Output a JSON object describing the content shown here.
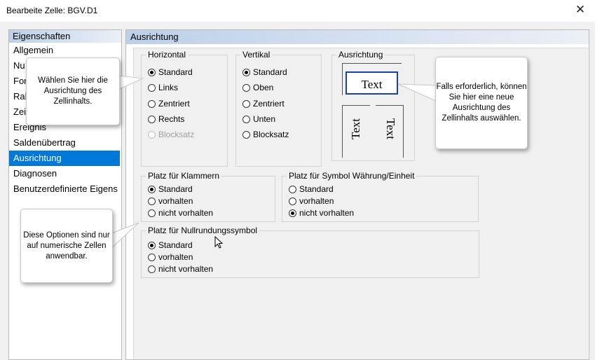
{
  "window": {
    "title": "Bearbeite Zelle: BGV.D1"
  },
  "sidebar": {
    "header": "Eigenschaften",
    "items": [
      {
        "label": "Allgemein"
      },
      {
        "label": "Nu"
      },
      {
        "label": "For"
      },
      {
        "label": "Rah"
      },
      {
        "label": "Zei"
      },
      {
        "label": "Ereignis"
      },
      {
        "label": "Saldenübertrag"
      },
      {
        "label": "Ausrichtung"
      },
      {
        "label": "Diagnosen"
      },
      {
        "label": "Benutzerdefinierte Eigens"
      }
    ],
    "selected_index": 7
  },
  "main": {
    "header": "Ausrichtung",
    "horizontal": {
      "legend": "Horizontal",
      "options": [
        "Standard",
        "Links",
        "Zentriert",
        "Rechts",
        "Blocksatz"
      ],
      "selected": "Standard",
      "disabled": "Blocksatz"
    },
    "vertikal": {
      "legend": "Vertikal",
      "options": [
        "Standard",
        "Oben",
        "Zentriert",
        "Unten",
        "Blocksatz"
      ],
      "selected": "Standard"
    },
    "ausrichtung": {
      "legend": "Ausrichtung",
      "sample_text": "Text"
    },
    "klammern": {
      "legend": "Platz für Klammern",
      "options": [
        "Standard",
        "vorhalten",
        "nicht vorhalten"
      ],
      "selected": "Standard"
    },
    "symbol": {
      "legend": "Platz für Symbol Währung/Einheit",
      "options": [
        "Standard",
        "vorhalten",
        "nicht vorhalten"
      ],
      "selected": "nicht vorhalten"
    },
    "nullrundung": {
      "legend": "Platz für Nullrundungssymbol",
      "options": [
        "Standard",
        "vorhalten",
        "nicht vorhalten"
      ],
      "selected": "Standard"
    }
  },
  "callouts": {
    "alignment_hint": "Wählen Sie hier die Ausrichtung des Zellinhalts.",
    "orientation_hint": "Falls erforderlich, können Sie hier eine neue Ausrichtung des Zellinhalts auswählen.",
    "numeric_hint": "Diese Optionen sind nur auf numerische Zellen anwendbar."
  },
  "colors": {
    "selection": "#0078d7",
    "header_gradient": "#bcd0e8",
    "text_box_border": "#1d3fa8"
  }
}
